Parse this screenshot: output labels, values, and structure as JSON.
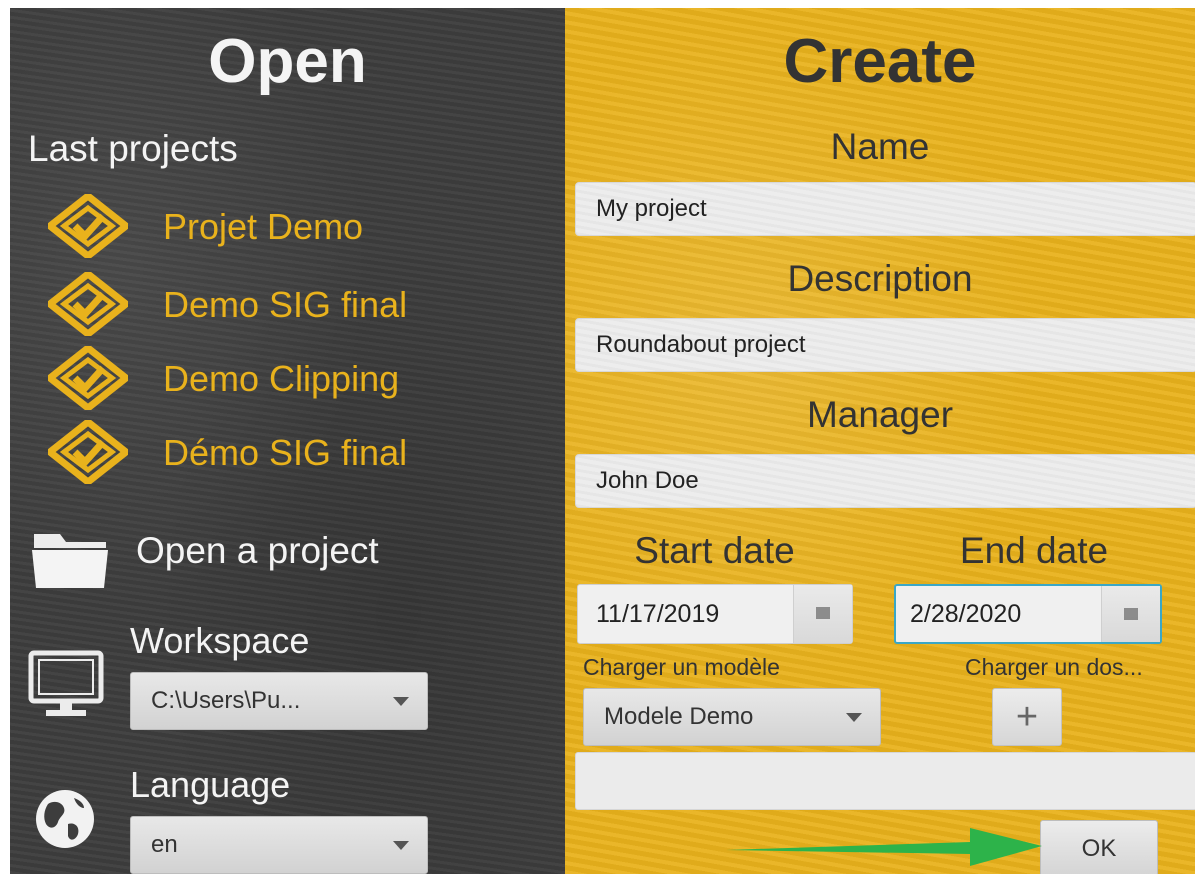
{
  "open": {
    "title": "Open",
    "last_projects_label": "Last projects",
    "projects": [
      {
        "label": "Projet Demo"
      },
      {
        "label": "Demo SIG final"
      },
      {
        "label": "Demo Clipping"
      },
      {
        "label": "Démo SIG final"
      }
    ],
    "open_project_label": "Open a project",
    "workspace": {
      "label": "Workspace",
      "value": "C:\\Users\\Pu..."
    },
    "language": {
      "label": "Language",
      "value": "en"
    }
  },
  "create": {
    "title": "Create",
    "name": {
      "label": "Name",
      "value": "My project"
    },
    "description": {
      "label": "Description",
      "value": "Roundabout project"
    },
    "manager": {
      "label": "Manager",
      "value": "John Doe"
    },
    "start_date": {
      "label": "Start date",
      "value": "11/17/2019"
    },
    "end_date": {
      "label": "End date",
      "value": "2/28/2020"
    },
    "template": {
      "label": "Charger un modèle",
      "value": "Modele Demo"
    },
    "folder": {
      "label": "Charger un dos...",
      "button": "+",
      "value": ""
    },
    "ok_label": "OK"
  },
  "colors": {
    "left_panel": "#3d3d3d",
    "right_panel": "#e9b21c",
    "accent": "#e9b21c",
    "focus": "#3aa7c6",
    "annotation_arrow": "#2db34a"
  },
  "icons": {
    "project": "project-diamond-icon",
    "folder": "folder-icon",
    "workspace": "monitor-icon",
    "language": "globe-icon",
    "calendar": "calendar-icon"
  }
}
